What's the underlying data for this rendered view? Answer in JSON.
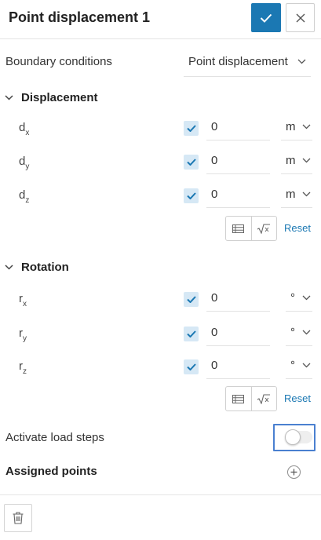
{
  "header": {
    "title": "Point displacement 1"
  },
  "boundary": {
    "label": "Boundary conditions",
    "value": "Point displacement"
  },
  "displacement": {
    "label": "Displacement",
    "rows": [
      {
        "symbol": "d",
        "sub": "x",
        "checked": true,
        "value": "0",
        "unit": "m"
      },
      {
        "symbol": "d",
        "sub": "y",
        "checked": true,
        "value": "0",
        "unit": "m"
      },
      {
        "symbol": "d",
        "sub": "z",
        "checked": true,
        "value": "0",
        "unit": "m"
      }
    ],
    "reset_label": "Reset"
  },
  "rotation": {
    "label": "Rotation",
    "rows": [
      {
        "symbol": "r",
        "sub": "x",
        "checked": true,
        "value": "0",
        "unit": "°"
      },
      {
        "symbol": "r",
        "sub": "y",
        "checked": true,
        "value": "0",
        "unit": "°"
      },
      {
        "symbol": "r",
        "sub": "z",
        "checked": true,
        "value": "0",
        "unit": "°"
      }
    ],
    "reset_label": "Reset"
  },
  "load_steps": {
    "label": "Activate load steps",
    "enabled": false
  },
  "assigned_points": {
    "label": "Assigned points"
  },
  "colors": {
    "accent": "#1b78b3",
    "checkbox_bg": "#d6e8f5",
    "focus_ring": "#4a80d0"
  }
}
